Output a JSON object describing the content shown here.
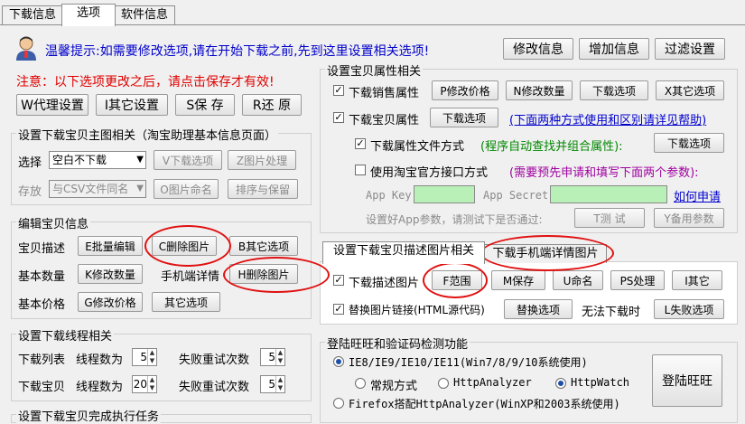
{
  "tabs": [
    "下载信息",
    "选项",
    "软件信息"
  ],
  "active_tab": "选项",
  "top": {
    "tip": "温馨提示:如需要修改选项,请在开始下载之前,先到这里设置相关选项!",
    "modify_info": "修改信息",
    "add_info": "增加信息",
    "filter_settings": "过滤设置",
    "notice": "注意：以下选项更改之后，请点击保存才有效!",
    "proxy_btn": "W代理设置",
    "other_settings_btn": "I其它设置",
    "save_btn": "S保 存",
    "restore_btn": "R还 原"
  },
  "main_image": {
    "title": "设置下载宝贝主图相关（淘宝助理基本信息页面）",
    "select_label": "选择",
    "select_value": "空白不下载",
    "v_download": "V下载选项",
    "z_process": "Z图片处理",
    "store_label": "存放",
    "store_value": "与CSV文件同名",
    "o_rename": "O图片命名",
    "sort_keep": "排序与保留"
  },
  "edit": {
    "title": "编辑宝贝信息",
    "desc_label": "宝贝描述",
    "batch_edit": "E批量编辑",
    "delete_img": "C删除图片",
    "other_opts_b": "B其它选项",
    "qty_label": "基本数量",
    "k_modify_qty": "K修改数量",
    "mobile_label": "手机端详情",
    "h_delete_img": "H删除图片",
    "price_label": "基本价格",
    "g_modify_price": "G修改价格",
    "other_opts": "其它选项"
  },
  "threads": {
    "title": "设置下载线程相关",
    "list_label": "下载列表",
    "item_label": "下载宝贝",
    "thread_count": "线程数为",
    "retry_count": "失败重试次数",
    "list_threads": "5",
    "list_retry": "5",
    "item_threads": "20",
    "item_retry": "5"
  },
  "after": {
    "title": "设置下载宝贝完成执行任务"
  },
  "attrs": {
    "title": "设置宝贝属性相关",
    "sales_label": "下载销售属性",
    "sales_checked": true,
    "p_modify_price": "P修改价格",
    "n_modify_qty": "N修改数量",
    "download_opts": "下载选项",
    "x_other_opts": "X其它选项",
    "item_attr_label": "下载宝贝属性",
    "item_attr_checked": true,
    "item_attr_btn": "下载选项",
    "item_attr_link": "(下面两种方式使用和区别请详见帮助)",
    "file_mode_label": "下载属性文件方式",
    "file_mode_checked": true,
    "file_mode_note": "(程序自动查找并组合属性):",
    "file_mode_btn": "下载选项",
    "api_label": "使用淘宝官方接口方式",
    "api_checked": false,
    "api_note": "(需要预先申请和填写下面两个参数):",
    "app_key_label": "App Key",
    "app_secret_label": "App Secret",
    "apply_link": "如何申请",
    "test_prompt": "设置好App参数，请测试下是否通过:",
    "t_test": "T测 试",
    "y_backup": "Y备用参数"
  },
  "desc_img": {
    "tab1": "设置下载宝贝描述图片相关",
    "tab2": "下载手机端详情图片",
    "desc_label": "下载描述图片",
    "desc_checked": true,
    "f_range": "F范围",
    "m_save": "M保存",
    "u_name": "U命名",
    "ps_process": "PS处理",
    "i_other": "I其它",
    "replace_label": "替换图片链接(HTML源代码)",
    "replace_checked": true,
    "replace_opts": "替换选项",
    "cannot_download": "无法下载时",
    "l_fail_opts": "L失败选项"
  },
  "login": {
    "title": "登陆旺旺和验证码检测功能",
    "ie_option": "IE8/IE9/IE10/IE11(Win7/8/9/10系统使用)",
    "normal": "常规方式",
    "httpanalyzer": "HttpAnalyzer",
    "httpwatch": "HttpWatch",
    "firefox_option": "Firefox搭配HttpAnalyzer(WinXP和2003系统使用)",
    "login_btn": "登陆旺旺"
  },
  "colors": {
    "notice": "#e00000",
    "link": "#0000cc",
    "green_note": "#008800",
    "purple_note": "#a000a0",
    "highlight_oval": "#e01010",
    "app_field": "#b8f0b8"
  }
}
